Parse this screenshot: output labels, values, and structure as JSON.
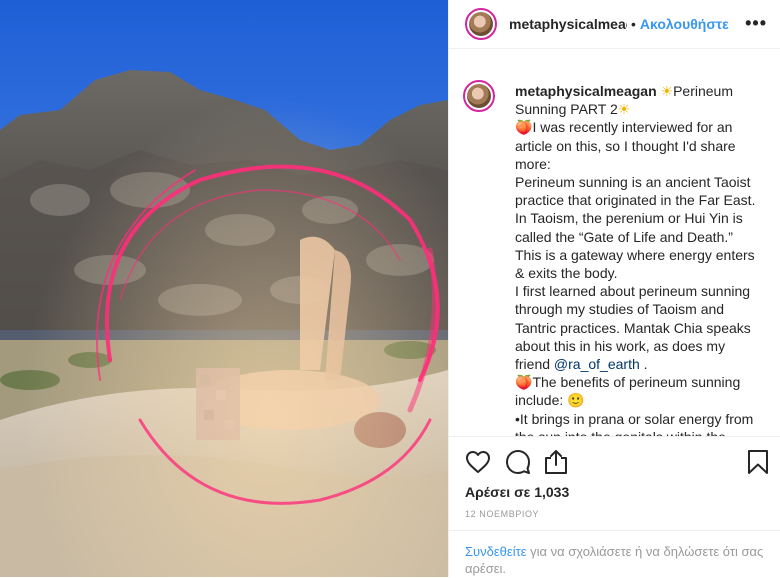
{
  "post": {
    "username": "metaphysicalmeagan",
    "header_username": "metaphysicalmeag",
    "separator": "•",
    "follow_label": "Ακολουθήστε",
    "more_label": "•••"
  },
  "caption": {
    "username": "metaphysicalmeagan",
    "title_emoji": "☀",
    "title": "Perineum Sunning PART 2",
    "peach_emoji": "🍑",
    "line1": "I was recently interviewed for an article on this, so I thought I'd share more:",
    "line2": "Perineum sunning is an ancient Taoist practice that originated in the Far East. In Taoism, the perenium or Hui Yin is called the “Gate of Life and Death.” This is a gateway where energy enters & exits the body.",
    "line3_before": "I first learned about perineum sunning through my studies of Taoism and Tantric practices. Mantak Chia speaks about this in his work, as does my friend ",
    "mention": "@ra_of_earth",
    "line3_after": " .",
    "line4": "The benefits of perineum sunning include: ",
    "line4_emoji": "🙂",
    "line5": "•It brings in prana or solar energy from the sun into the genitals within the"
  },
  "stats": {
    "likes": "Αρέσει σε 1,033",
    "date": "12 ΝΟΕΜΒΡΙΟΥ"
  },
  "login": {
    "link": "Συνδεθείτε",
    "rest": " για να σχολιάσετε ή να δηλώσετε ότι σας αρέσει."
  },
  "icons": {
    "heart": "heart-icon",
    "comment": "comment-icon",
    "share": "share-icon",
    "bookmark": "bookmark-icon"
  },
  "colors": {
    "accent": "#3897f0",
    "text": "#262626",
    "muted": "#999999"
  }
}
